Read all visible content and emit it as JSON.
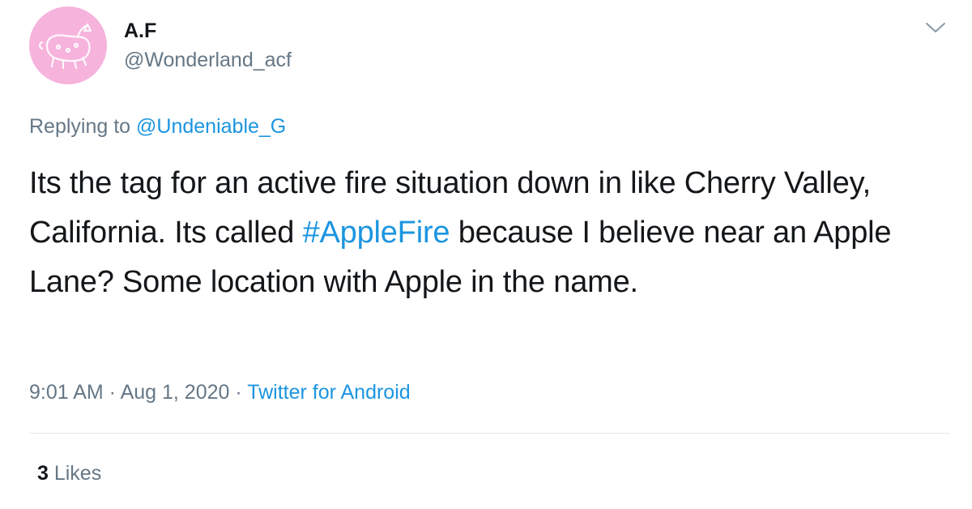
{
  "author": {
    "name": "A.F",
    "handle": "@Wonderland_acf",
    "avatar_color": "#f6b3dc"
  },
  "reply": {
    "prefix": "Replying to ",
    "mention": "@Undeniable_G"
  },
  "tweet": {
    "text_part1": "Its the tag for an active fire situation down in like Cherry Valley, California. Its called ",
    "hashtag": "#AppleFire",
    "text_part2": " because I believe near an Apple Lane? Some location with Apple in the name."
  },
  "meta": {
    "time": "9:01 AM",
    "separator": " · ",
    "date": "Aug 1, 2020",
    "source": "Twitter for Android"
  },
  "stats": {
    "likes_count": "3",
    "likes_label": " Likes"
  },
  "colors": {
    "link": "#1b95e0",
    "secondary_text": "#657786",
    "divider": "#e1e8ed"
  },
  "icons": {
    "menu": "chevron-down-icon"
  }
}
